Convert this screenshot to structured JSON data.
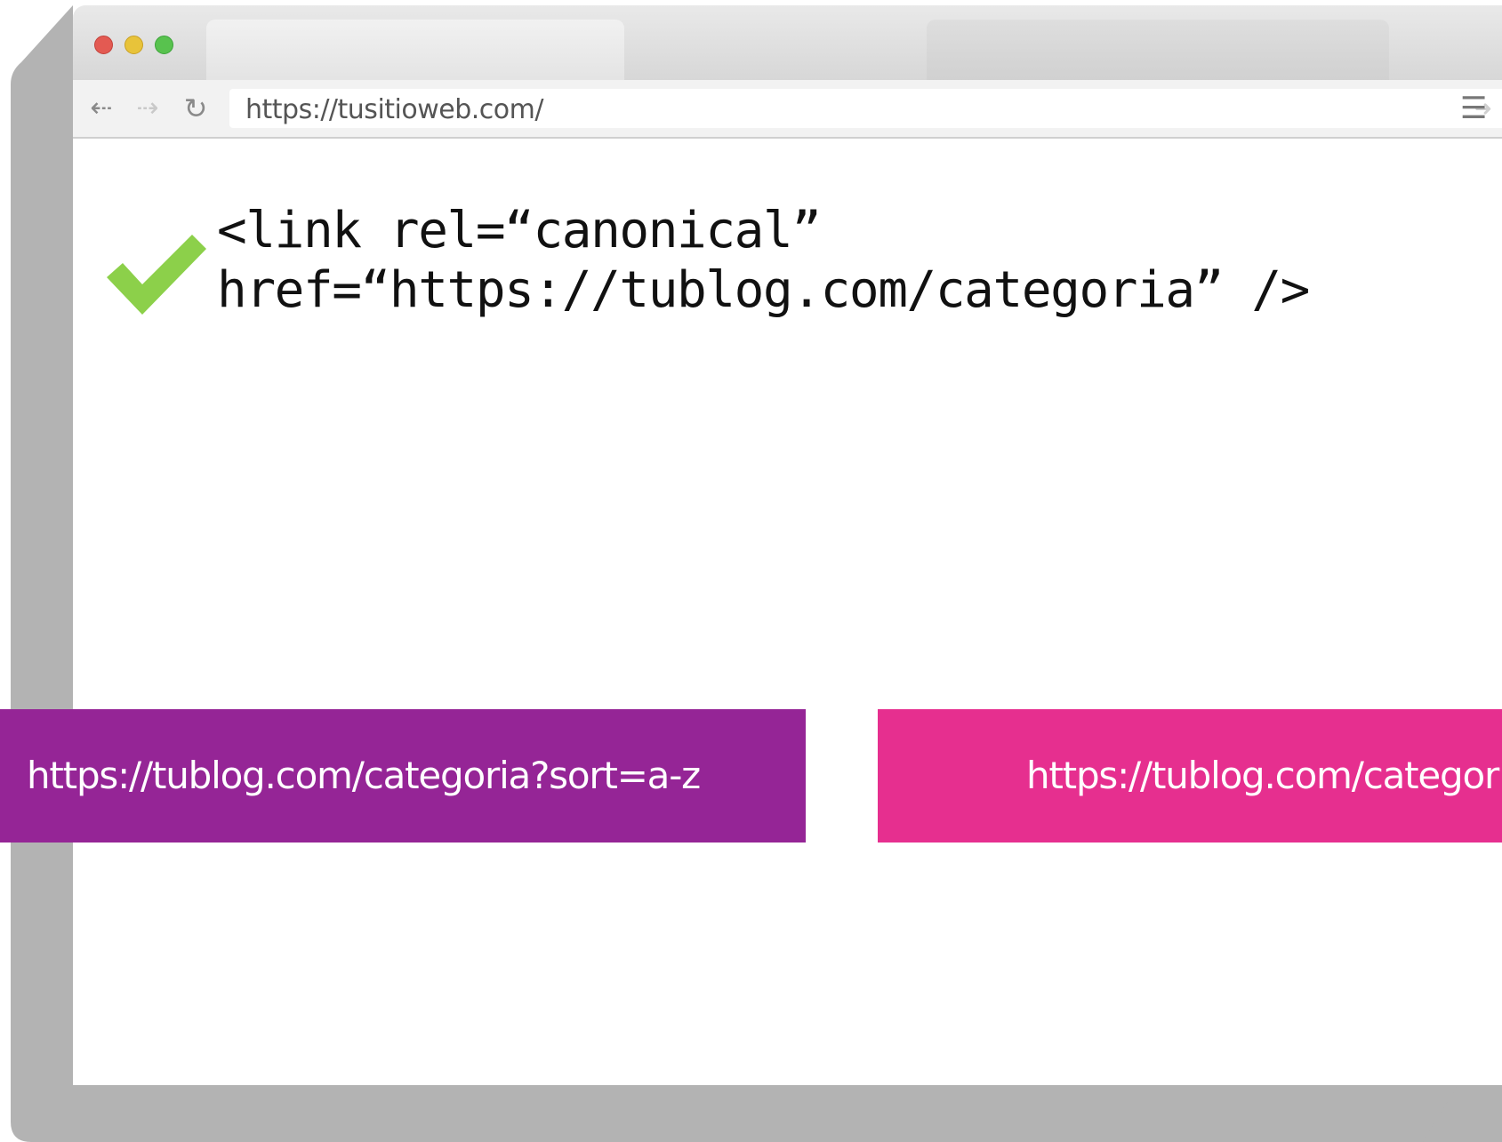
{
  "browser": {
    "address_bar": {
      "url": "https://tusitioweb.com/"
    },
    "nav": {
      "back_icon": "back-arrow-icon",
      "forward_icon": "forward-arrow-icon",
      "reload_icon": "reload-icon",
      "menu_icon": "hamburger-menu-icon"
    },
    "window_controls": [
      "close",
      "minimize",
      "maximize"
    ]
  },
  "content": {
    "check_icon": "green-checkmark-icon",
    "code_line_1": "<link rel=“canonical”",
    "code_line_2": "href=“https://tublog.com/categoria” />"
  },
  "url_boxes": {
    "left": {
      "text": "https://tublog.com/categoria?sort=a-z",
      "color": "#952596"
    },
    "right": {
      "text": "https://tublog.com/categoria",
      "color": "#e62f8f"
    }
  },
  "colors": {
    "check": "#8cd04a",
    "frame_shadow": "#b3b3b3"
  }
}
